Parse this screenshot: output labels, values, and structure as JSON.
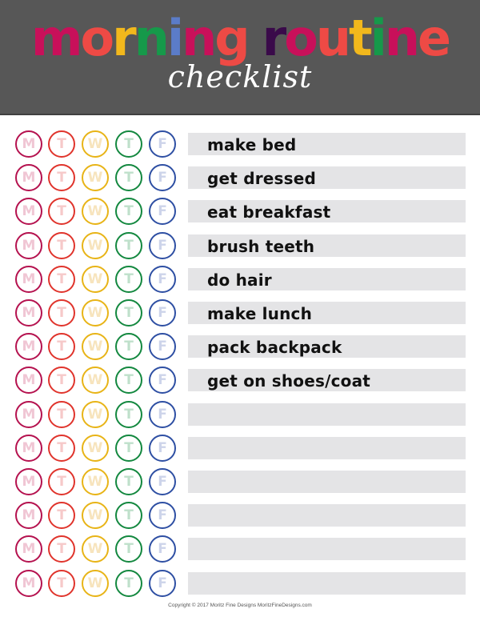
{
  "header": {
    "background": "#575757",
    "title_words": [
      [
        {
          "ch": "m",
          "color": "#c8105a"
        },
        {
          "ch": "o",
          "color": "#ee4a45"
        },
        {
          "ch": "r",
          "color": "#f2b81c"
        },
        {
          "ch": "n",
          "color": "#16994a"
        },
        {
          "ch": "i",
          "color": "#5b7cc8"
        },
        {
          "ch": "n",
          "color": "#c8105a"
        },
        {
          "ch": "g",
          "color": "#ee4a45"
        }
      ],
      [
        {
          "ch": "r",
          "color": "#3a0a4a"
        },
        {
          "ch": "o",
          "color": "#c8105a"
        },
        {
          "ch": "u",
          "color": "#ee4a45"
        },
        {
          "ch": "t",
          "color": "#f2b81c"
        },
        {
          "ch": "i",
          "color": "#16994a"
        },
        {
          "ch": "n",
          "color": "#c8105a"
        },
        {
          "ch": "e",
          "color": "#ee4a45"
        }
      ]
    ],
    "subtitle": "checklist"
  },
  "days": [
    {
      "letter": "M",
      "ring": "#b5124f",
      "text": "#f0c6d4"
    },
    {
      "letter": "T",
      "ring": "#e0342c",
      "text": "#f6c9c9"
    },
    {
      "letter": "W",
      "ring": "#e8b417",
      "text": "#f7e4bd"
    },
    {
      "letter": "T",
      "ring": "#13883f",
      "text": "#bfe0cb"
    },
    {
      "letter": "F",
      "ring": "#2e4fa3",
      "text": "#cdd4ea"
    }
  ],
  "tasks": [
    "make bed",
    "get dressed",
    "eat breakfast",
    "brush teeth",
    "do hair",
    "make lunch",
    "pack backpack",
    "get on shoes/coat",
    "",
    "",
    "",
    "",
    "",
    ""
  ],
  "footer": "Copyright © 2017 Moritz Fine Designs  MoritzFineDesigns.com"
}
